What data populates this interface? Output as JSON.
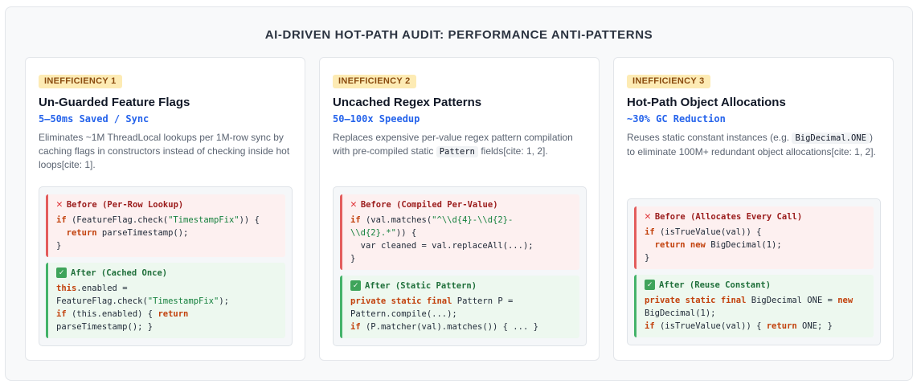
{
  "title": "AI-DRIVEN HOT-PATH AUDIT: PERFORMANCE ANTI-PATTERNS",
  "cards": [
    {
      "badge": "INEFFICIENCY 1",
      "title": "Un-Guarded Feature Flags",
      "metric": "5–50ms Saved / Sync",
      "desc_html": "Eliminates ~1M ThreadLocal lookups per 1M-row sync by caching flags in constructors instead of checking inside hot loops[cite: 1].",
      "before": {
        "label": "Before (Per-Row Lookup)",
        "code_html": "<span class=\"kw\">if</span> (FeatureFlag.check(<span class=\"str\">\"TimestampFix\"</span>)) {\n  <span class=\"kw\">return</span> parseTimestamp();\n}"
      },
      "after": {
        "label": "After (Cached Once)",
        "code_html": "<span class=\"kw\">this</span>.enabled =\nFeatureFlag.check(<span class=\"str\">\"TimestampFix\"</span>);\n<span class=\"kw\">if</span> (this.enabled) { <span class=\"kw\">return</span>\nparseTimestamp(); }"
      }
    },
    {
      "badge": "INEFFICIENCY 2",
      "title": "Uncached Regex Patterns",
      "metric": "50–100x Speedup",
      "desc_html": "Replaces expensive per-value regex pattern compilation with pre-compiled static <span class=\"code-inline\">Pattern</span> fields[cite: 1, 2].",
      "before": {
        "label": "Before (Compiled Per-Value)",
        "code_html": "<span class=\"kw\">if</span> (val.matches(<span class=\"str\">\"^\\\\d{4}-\\\\d{2}-\n\\\\d{2}.*\"</span>)) {\n  var cleaned = val.replaceAll(...);\n}"
      },
      "after": {
        "label": "After (Static Pattern)",
        "code_html": "<span class=\"kw\">private static final</span> Pattern P =\nPattern.compile(...);\n<span class=\"kw\">if</span> (P.matcher(val).matches()) { ... }"
      }
    },
    {
      "badge": "INEFFICIENCY 3",
      "title": "Hot-Path Object Allocations",
      "metric": "~30% GC Reduction",
      "desc_html": "Reuses static constant instances (e.g. <span class=\"code-inline\">BigDecimal.ONE</span>) to eliminate 100M+ redundant object allocations[cite: 1, 2].",
      "before": {
        "label": "Before (Allocates Every Call)",
        "code_html": "<span class=\"kw\">if</span> (isTrueValue(val)) {\n  <span class=\"kw\">return new</span> BigDecimal(1);\n}"
      },
      "after": {
        "label": "After (Reuse Constant)",
        "code_html": "<span class=\"kw\">private static final</span> BigDecimal ONE = <span class=\"kw\">new</span>\nBigDecimal(1);\n<span class=\"kw\">if</span> (isTrueValue(val)) { <span class=\"kw\">return</span> ONE; }"
      }
    }
  ]
}
